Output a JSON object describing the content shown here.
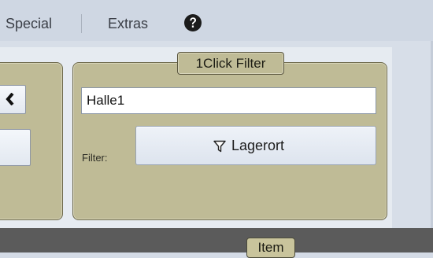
{
  "menu": {
    "items": [
      "Special",
      "Extras"
    ],
    "help_icon": "question-circle-icon"
  },
  "left_group": {
    "nav_icon": "chevron-left-icon"
  },
  "filter_group": {
    "title": "1Click Filter",
    "input_value": "Halle1",
    "filter_label": "Filter:",
    "button_label": "Lagerort",
    "button_icon": "funnel-icon"
  },
  "bottom": {
    "tab_label": "Item"
  },
  "colors": {
    "menubar_bg": "#cfd7e3",
    "group_bg": "#bfbb96",
    "group_border": "#6e6a4c",
    "bottom_strip": "#5b5b5b"
  }
}
